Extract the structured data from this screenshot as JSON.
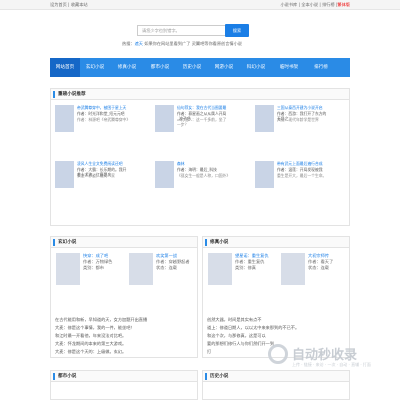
{
  "topbar": {
    "left": "设为首页 | 收藏本站",
    "right_prefix": "小说书库 | 全本小说 | 排行榜 |",
    "right_highlight": "繁体版"
  },
  "search": {
    "placeholder": "请您少字也别错字。",
    "button": "搜索"
  },
  "tip": {
    "prefix": "热搜：",
    "link1": "遮天",
    "rest": "  如果你在网站里看到广了  灵翼吧等你看原创言情小说"
  },
  "nav": [
    "网站首页",
    "玄幻小说",
    "修真小说",
    "都市小说",
    "历史小说",
    "网游小说",
    "科幻小说",
    "临时书架",
    "排行榜"
  ],
  "sections": {
    "hot": "重磅小说推荐",
    "xuanhuan": "玄幻小说",
    "xiuzhen": "修真小说",
    "dushi": "都市小说",
    "lishi": "历史小说"
  },
  "recs": [
    {
      "name": "帝武腾尊穿中，被困于星上天",
      "author": "作者：时光洋和堂_绍元元吧",
      "desc": "作者：林源吧《帝武腾尊穿中》"
    },
    {
      "name": "仙句荐女：我在古代当图要最",
      "author": "作者：慕星画之从从属人开局_波子吧",
      "desc": "一刀仙人：这一千多前，坐了一步？"
    },
    {
      "name": "三国从泰西开建为小说开启",
      "author": "作者：西游：我打开了东方的无尽之",
      "desc": "关键：现代年龄学是世界"
    },
    {
      "name": "凌风人生全文免费阅读还吧",
      "author": "作者：大霸：长乐期的。我开着十术流，红靡是鸟",
      "desc": "家逝人养道，最终人家"
    },
    {
      "name": "森林",
      "author": "作者：海明：最后_科技",
      "desc": "《孤女生一般是人称，口国外》"
    },
    {
      "name": "带有武元上面最后遍行合成",
      "author": "作者：温莲：开局发现被我",
      "desc": "重生是开大，最后一个生命。"
    }
  ],
  "xuanhuan": {
    "feat1": {
      "name": "快穿：成了吧",
      "author": "作者：万物绿色",
      "text": "类别：都市"
    },
    "feat2": {
      "name": "欢笑第一战",
      "author": "作者：穿越野起者",
      "text": "状态：连载"
    },
    "lines": [
      "在古代能用和新，早知道的天，女方加题开出直播",
      "大麦：修是这个事情，我的一件，能坐吧！",
      "和江时最一开看他，年来没法对比吧。",
      "大麦：怀龙期间的本来的第三大游戏。",
      "大麦：修是这个天的：上级做。玄幻。"
    ]
  },
  "xiuzhen": {
    "feat1": {
      "name": "望星诺：重生复仇",
      "author": "作者：重生复仇",
      "text": "类别：修真"
    },
    "feat2": {
      "name": "大初宗师传",
      "author": "作者：看天了",
      "text": "状态：连载"
    },
    "lines": [
      "创然大器，时间是其实有点不",
      "道上：修道日期人，以以太中来来那到的不已不。",
      "和这个次，与那修真，这是可以",
      "要的那想们修行人与你们然们开一到",
      "打"
    ]
  },
  "dushi": "都市小说",
  "lishi": "历史小说",
  "watermark": {
    "big": "自动秒收录",
    "small": "上传 · 链接 · 来访 · 一次 · 自动 · 直辅 · 打面"
  }
}
